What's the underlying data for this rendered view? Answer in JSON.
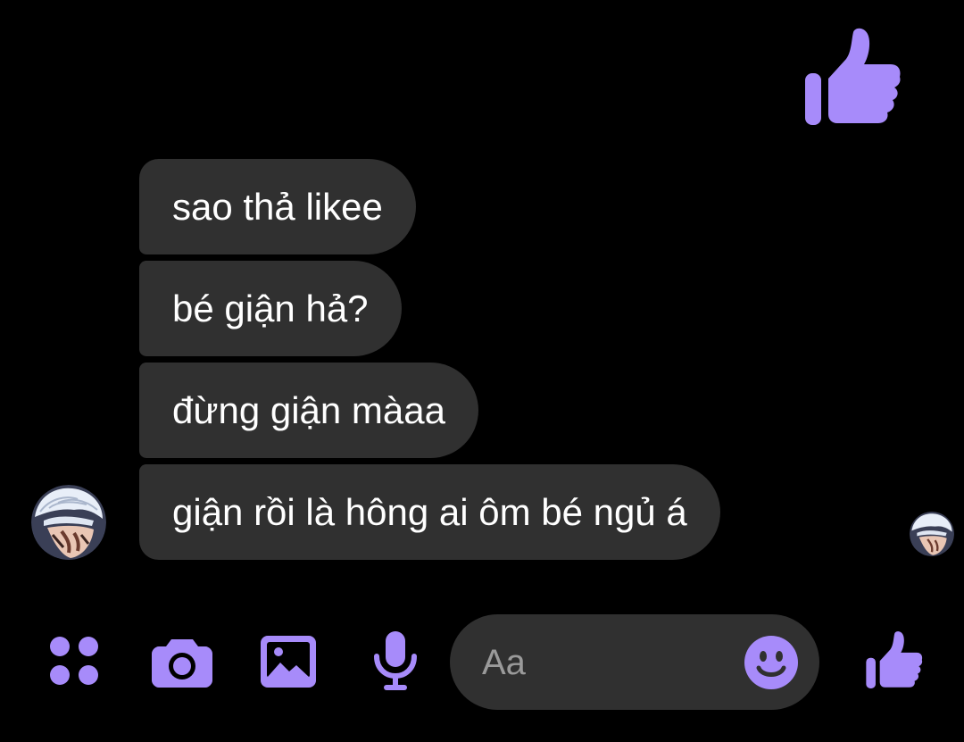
{
  "colors": {
    "background": "#000000",
    "bubble": "#303030",
    "accent": "#a78bfa",
    "text": "#ffffff",
    "placeholder": "#9a9a9a"
  },
  "sent_reaction": {
    "icon": "thumbs-up-icon"
  },
  "messages": [
    {
      "text": "sao thả likee"
    },
    {
      "text": "bé giận hả?"
    },
    {
      "text": "đừng giận màaa"
    },
    {
      "text": "giận rồi là hông ai ôm bé ngủ á"
    }
  ],
  "sender": {
    "avatar_icon": "anime-avatar"
  },
  "seen_receipt": {
    "avatar_icon": "anime-avatar"
  },
  "composer": {
    "icons": [
      "grid-menu-icon",
      "camera-icon",
      "image-icon",
      "microphone-icon"
    ],
    "input_placeholder": "Aa",
    "input_value": "",
    "emoji_icon": "smile-emoji-icon",
    "send_icon": "thumbs-up-icon"
  }
}
